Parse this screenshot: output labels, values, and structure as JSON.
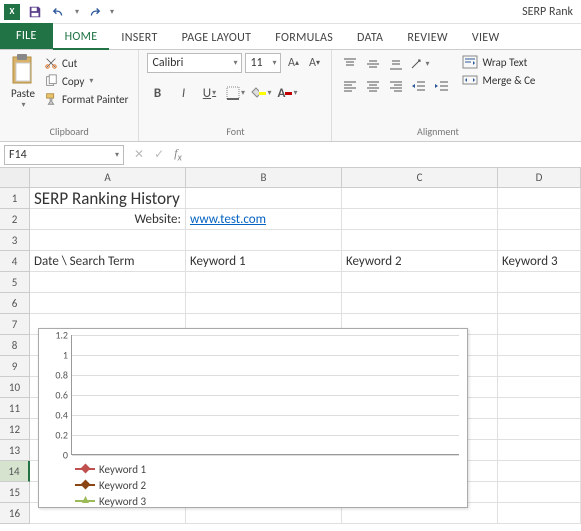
{
  "window": {
    "title_right": "SERP Rank"
  },
  "tabs": {
    "file": "FILE",
    "home": "HOME",
    "insert": "INSERT",
    "page_layout": "PAGE LAYOUT",
    "formulas": "FORMULAS",
    "data": "DATA",
    "review": "REVIEW",
    "view": "VIEW"
  },
  "ribbon": {
    "clipboard": {
      "paste": "Paste",
      "cut": "Cut",
      "copy": "Copy",
      "format_painter": "Format Painter",
      "label": "Clipboard"
    },
    "font": {
      "name": "Calibri",
      "size": "11",
      "label": "Font",
      "fill_color": "#ffff00",
      "font_color": "#c00000"
    },
    "alignment": {
      "wrap": "Wrap Text",
      "merge": "Merge & Ce",
      "label": "Alignment"
    }
  },
  "namebox": {
    "ref": "F14"
  },
  "columns": [
    "A",
    "B",
    "C",
    "D"
  ],
  "sheet": {
    "r1": {
      "A": "SERP Ranking History"
    },
    "r2": {
      "A": "Website:",
      "B": "www.test.com"
    },
    "r4": {
      "A": "Date \\ Search Term",
      "B": "Keyword 1",
      "C": "Keyword 2",
      "D": "Keyword 3"
    }
  },
  "chart_data": {
    "type": "line",
    "title": "",
    "xlabel": "",
    "ylabel": "",
    "ylim": [
      0,
      1.2
    ],
    "yticks": [
      0,
      0.2,
      0.4,
      0.6,
      0.8,
      1,
      1.2
    ],
    "categories": [],
    "series": [
      {
        "name": "Keyword 1",
        "color": "#c0504d",
        "values": []
      },
      {
        "name": "Keyword 2",
        "color": "#8b4513",
        "values": []
      },
      {
        "name": "Keyword 3",
        "color": "#9bbb59",
        "values": []
      }
    ]
  }
}
